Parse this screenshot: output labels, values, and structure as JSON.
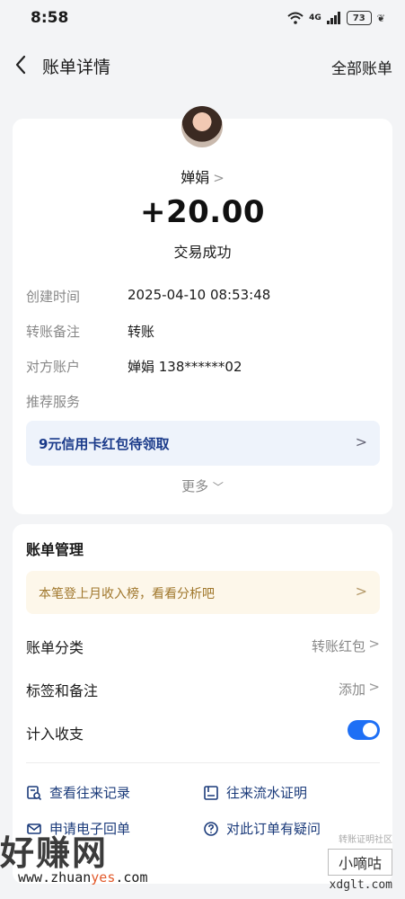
{
  "status_bar": {
    "time": "8:58",
    "network": "4G",
    "battery": "73"
  },
  "nav": {
    "title": "账单详情",
    "right_action": "全部账单"
  },
  "transaction": {
    "payee": "婵娟",
    "amount": "+20.00",
    "status": "交易成功",
    "details": [
      {
        "label": "创建时间",
        "value": "2025-04-10 08:53:48"
      },
      {
        "label": "转账备注",
        "value": "转账"
      },
      {
        "label": "对方账户",
        "value": "婵娟 138******02"
      },
      {
        "label": "推荐服务",
        "value": ""
      }
    ],
    "promo": "9元信用卡红包待领取",
    "more": "更多"
  },
  "management": {
    "title": "账单管理",
    "banner": "本笔登上月收入榜，看看分析吧",
    "rows": [
      {
        "label": "账单分类",
        "value": "转账红包"
      },
      {
        "label": "标签和备注",
        "value": "添加"
      },
      {
        "label": "计入收支",
        "value": ""
      }
    ],
    "toggle_on": true,
    "links": [
      "查看往来记录",
      "往来流水证明",
      "申请电子回单",
      "对此订单有疑问"
    ]
  },
  "watermark": {
    "left_brand": "好赚网",
    "left_url_pre": "www.zhuan",
    "left_url_hl": "yes",
    "left_url_post": ".com",
    "right_small": "转账证明社区",
    "right_brand": "小嘀咕",
    "right_url": "xdglt.com"
  },
  "colors": {
    "accent": "#1e6ff5",
    "promo_text": "#1a3a8a",
    "banner_text": "#a0772c"
  }
}
